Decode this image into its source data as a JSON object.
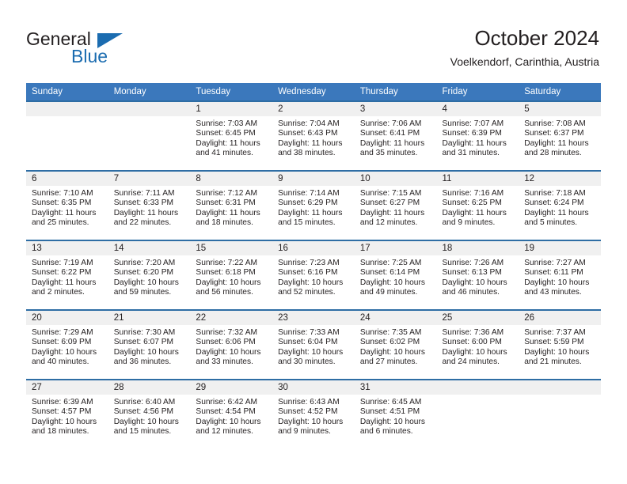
{
  "brand": {
    "name_top": "General",
    "name_bottom": "Blue",
    "triangle_color": "#1b6cb0",
    "text_color": "#231f20"
  },
  "header": {
    "title": "October 2024",
    "location": "Voelkendorf, Carinthia, Austria"
  },
  "theme": {
    "header_bg": "#3b78bc",
    "row_border": "#2e6da4",
    "daynum_bg": "#f0f0f0",
    "text": "#231f20"
  },
  "labels": {
    "sunrise_prefix": "Sunrise:",
    "sunset_prefix": "Sunset:",
    "daylight_prefix": "Daylight:"
  },
  "weekdays": [
    "Sunday",
    "Monday",
    "Tuesday",
    "Wednesday",
    "Thursday",
    "Friday",
    "Saturday"
  ],
  "weeks": [
    [
      {
        "day": "",
        "empty": true,
        "sunrise": "",
        "sunset": "",
        "daylight_line1": "",
        "daylight_line2": ""
      },
      {
        "day": "",
        "empty": true,
        "sunrise": "",
        "sunset": "",
        "daylight_line1": "",
        "daylight_line2": ""
      },
      {
        "day": "1",
        "empty": false,
        "sunrise": "Sunrise: 7:03 AM",
        "sunset": "Sunset: 6:45 PM",
        "daylight_line1": "Daylight: 11 hours",
        "daylight_line2": "and 41 minutes."
      },
      {
        "day": "2",
        "empty": false,
        "sunrise": "Sunrise: 7:04 AM",
        "sunset": "Sunset: 6:43 PM",
        "daylight_line1": "Daylight: 11 hours",
        "daylight_line2": "and 38 minutes."
      },
      {
        "day": "3",
        "empty": false,
        "sunrise": "Sunrise: 7:06 AM",
        "sunset": "Sunset: 6:41 PM",
        "daylight_line1": "Daylight: 11 hours",
        "daylight_line2": "and 35 minutes."
      },
      {
        "day": "4",
        "empty": false,
        "sunrise": "Sunrise: 7:07 AM",
        "sunset": "Sunset: 6:39 PM",
        "daylight_line1": "Daylight: 11 hours",
        "daylight_line2": "and 31 minutes."
      },
      {
        "day": "5",
        "empty": false,
        "sunrise": "Sunrise: 7:08 AM",
        "sunset": "Sunset: 6:37 PM",
        "daylight_line1": "Daylight: 11 hours",
        "daylight_line2": "and 28 minutes."
      }
    ],
    [
      {
        "day": "6",
        "empty": false,
        "sunrise": "Sunrise: 7:10 AM",
        "sunset": "Sunset: 6:35 PM",
        "daylight_line1": "Daylight: 11 hours",
        "daylight_line2": "and 25 minutes."
      },
      {
        "day": "7",
        "empty": false,
        "sunrise": "Sunrise: 7:11 AM",
        "sunset": "Sunset: 6:33 PM",
        "daylight_line1": "Daylight: 11 hours",
        "daylight_line2": "and 22 minutes."
      },
      {
        "day": "8",
        "empty": false,
        "sunrise": "Sunrise: 7:12 AM",
        "sunset": "Sunset: 6:31 PM",
        "daylight_line1": "Daylight: 11 hours",
        "daylight_line2": "and 18 minutes."
      },
      {
        "day": "9",
        "empty": false,
        "sunrise": "Sunrise: 7:14 AM",
        "sunset": "Sunset: 6:29 PM",
        "daylight_line1": "Daylight: 11 hours",
        "daylight_line2": "and 15 minutes."
      },
      {
        "day": "10",
        "empty": false,
        "sunrise": "Sunrise: 7:15 AM",
        "sunset": "Sunset: 6:27 PM",
        "daylight_line1": "Daylight: 11 hours",
        "daylight_line2": "and 12 minutes."
      },
      {
        "day": "11",
        "empty": false,
        "sunrise": "Sunrise: 7:16 AM",
        "sunset": "Sunset: 6:25 PM",
        "daylight_line1": "Daylight: 11 hours",
        "daylight_line2": "and 9 minutes."
      },
      {
        "day": "12",
        "empty": false,
        "sunrise": "Sunrise: 7:18 AM",
        "sunset": "Sunset: 6:24 PM",
        "daylight_line1": "Daylight: 11 hours",
        "daylight_line2": "and 5 minutes."
      }
    ],
    [
      {
        "day": "13",
        "empty": false,
        "sunrise": "Sunrise: 7:19 AM",
        "sunset": "Sunset: 6:22 PM",
        "daylight_line1": "Daylight: 11 hours",
        "daylight_line2": "and 2 minutes."
      },
      {
        "day": "14",
        "empty": false,
        "sunrise": "Sunrise: 7:20 AM",
        "sunset": "Sunset: 6:20 PM",
        "daylight_line1": "Daylight: 10 hours",
        "daylight_line2": "and 59 minutes."
      },
      {
        "day": "15",
        "empty": false,
        "sunrise": "Sunrise: 7:22 AM",
        "sunset": "Sunset: 6:18 PM",
        "daylight_line1": "Daylight: 10 hours",
        "daylight_line2": "and 56 minutes."
      },
      {
        "day": "16",
        "empty": false,
        "sunrise": "Sunrise: 7:23 AM",
        "sunset": "Sunset: 6:16 PM",
        "daylight_line1": "Daylight: 10 hours",
        "daylight_line2": "and 52 minutes."
      },
      {
        "day": "17",
        "empty": false,
        "sunrise": "Sunrise: 7:25 AM",
        "sunset": "Sunset: 6:14 PM",
        "daylight_line1": "Daylight: 10 hours",
        "daylight_line2": "and 49 minutes."
      },
      {
        "day": "18",
        "empty": false,
        "sunrise": "Sunrise: 7:26 AM",
        "sunset": "Sunset: 6:13 PM",
        "daylight_line1": "Daylight: 10 hours",
        "daylight_line2": "and 46 minutes."
      },
      {
        "day": "19",
        "empty": false,
        "sunrise": "Sunrise: 7:27 AM",
        "sunset": "Sunset: 6:11 PM",
        "daylight_line1": "Daylight: 10 hours",
        "daylight_line2": "and 43 minutes."
      }
    ],
    [
      {
        "day": "20",
        "empty": false,
        "sunrise": "Sunrise: 7:29 AM",
        "sunset": "Sunset: 6:09 PM",
        "daylight_line1": "Daylight: 10 hours",
        "daylight_line2": "and 40 minutes."
      },
      {
        "day": "21",
        "empty": false,
        "sunrise": "Sunrise: 7:30 AM",
        "sunset": "Sunset: 6:07 PM",
        "daylight_line1": "Daylight: 10 hours",
        "daylight_line2": "and 36 minutes."
      },
      {
        "day": "22",
        "empty": false,
        "sunrise": "Sunrise: 7:32 AM",
        "sunset": "Sunset: 6:06 PM",
        "daylight_line1": "Daylight: 10 hours",
        "daylight_line2": "and 33 minutes."
      },
      {
        "day": "23",
        "empty": false,
        "sunrise": "Sunrise: 7:33 AM",
        "sunset": "Sunset: 6:04 PM",
        "daylight_line1": "Daylight: 10 hours",
        "daylight_line2": "and 30 minutes."
      },
      {
        "day": "24",
        "empty": false,
        "sunrise": "Sunrise: 7:35 AM",
        "sunset": "Sunset: 6:02 PM",
        "daylight_line1": "Daylight: 10 hours",
        "daylight_line2": "and 27 minutes."
      },
      {
        "day": "25",
        "empty": false,
        "sunrise": "Sunrise: 7:36 AM",
        "sunset": "Sunset: 6:00 PM",
        "daylight_line1": "Daylight: 10 hours",
        "daylight_line2": "and 24 minutes."
      },
      {
        "day": "26",
        "empty": false,
        "sunrise": "Sunrise: 7:37 AM",
        "sunset": "Sunset: 5:59 PM",
        "daylight_line1": "Daylight: 10 hours",
        "daylight_line2": "and 21 minutes."
      }
    ],
    [
      {
        "day": "27",
        "empty": false,
        "sunrise": "Sunrise: 6:39 AM",
        "sunset": "Sunset: 4:57 PM",
        "daylight_line1": "Daylight: 10 hours",
        "daylight_line2": "and 18 minutes."
      },
      {
        "day": "28",
        "empty": false,
        "sunrise": "Sunrise: 6:40 AM",
        "sunset": "Sunset: 4:56 PM",
        "daylight_line1": "Daylight: 10 hours",
        "daylight_line2": "and 15 minutes."
      },
      {
        "day": "29",
        "empty": false,
        "sunrise": "Sunrise: 6:42 AM",
        "sunset": "Sunset: 4:54 PM",
        "daylight_line1": "Daylight: 10 hours",
        "daylight_line2": "and 12 minutes."
      },
      {
        "day": "30",
        "empty": false,
        "sunrise": "Sunrise: 6:43 AM",
        "sunset": "Sunset: 4:52 PM",
        "daylight_line1": "Daylight: 10 hours",
        "daylight_line2": "and 9 minutes."
      },
      {
        "day": "31",
        "empty": false,
        "sunrise": "Sunrise: 6:45 AM",
        "sunset": "Sunset: 4:51 PM",
        "daylight_line1": "Daylight: 10 hours",
        "daylight_line2": "and 6 minutes."
      },
      {
        "day": "",
        "empty": true,
        "sunrise": "",
        "sunset": "",
        "daylight_line1": "",
        "daylight_line2": ""
      },
      {
        "day": "",
        "empty": true,
        "sunrise": "",
        "sunset": "",
        "daylight_line1": "",
        "daylight_line2": ""
      }
    ]
  ]
}
